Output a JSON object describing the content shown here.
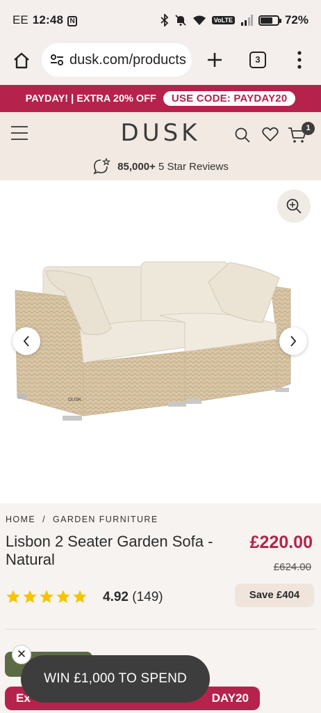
{
  "status_bar": {
    "carrier": "EE",
    "time": "12:48",
    "nfc_glyph": "N",
    "network_badge": "VoLTE",
    "battery": "72%",
    "battery_level": 0.72,
    "icons": [
      "bluetooth-icon",
      "mute-icon",
      "wifi-icon",
      "signal-icon",
      "battery-icon"
    ]
  },
  "browser": {
    "url": "dusk.com/products",
    "tab_count": "3",
    "icons": [
      "home-icon",
      "site-settings-icon",
      "new-tab-icon",
      "menu-icon"
    ]
  },
  "promo": {
    "text": "PAYDAY! | EXTRA 20% OFF",
    "code_label": "USE CODE: PAYDAY20"
  },
  "header": {
    "logo": "DUSK",
    "cart_count": "1",
    "reviews_count": "85,000+",
    "reviews_label": "5 Star Reviews"
  },
  "breadcrumb": {
    "home": "HOME",
    "separator": "/",
    "category": "GARDEN FURNITURE"
  },
  "product": {
    "title": "Lisbon 2 Seater Garden Sofa - Natural",
    "price": "£220.00",
    "was_price": "£624.00",
    "rating": "4.92",
    "review_count": "(149)",
    "stars": 5,
    "save_label": "Save £404",
    "image_brand_tag": "DUSK"
  },
  "bottom": {
    "promo_left": "Ex",
    "promo_right": "DAY20",
    "toast": "WIN £1,000 TO SPEND",
    "toast_close": "✕"
  },
  "colors": {
    "brand_red": "#b5234c",
    "header_bg": "#f1e9e2",
    "star": "#f5c400",
    "olive": "#5c6b45"
  }
}
